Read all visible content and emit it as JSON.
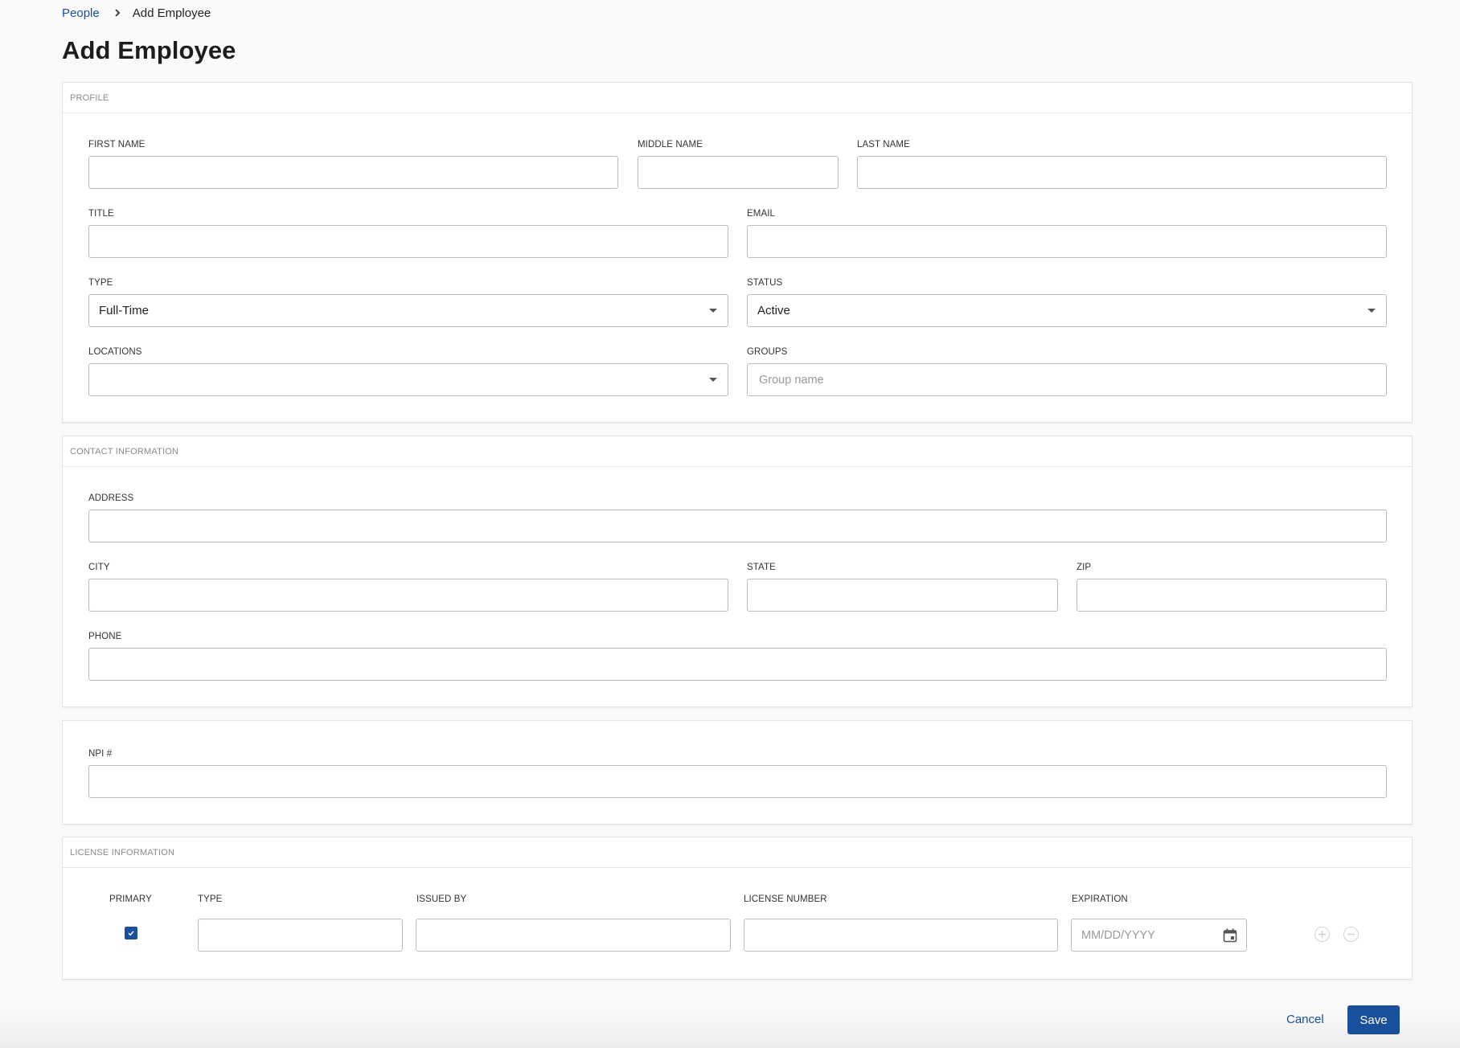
{
  "breadcrumb": {
    "parent": "People",
    "current": "Add Employee"
  },
  "page": {
    "title": "Add Employee"
  },
  "profile": {
    "header": "PROFILE",
    "first_name": {
      "label": "FIRST NAME",
      "value": ""
    },
    "middle_name": {
      "label": "MIDDLE NAME",
      "value": ""
    },
    "last_name": {
      "label": "LAST NAME",
      "value": ""
    },
    "title": {
      "label": "TITLE",
      "value": ""
    },
    "email": {
      "label": "EMAIL",
      "value": ""
    },
    "type": {
      "label": "TYPE",
      "value": "Full-Time"
    },
    "status": {
      "label": "STATUS",
      "value": "Active"
    },
    "locations": {
      "label": "LOCATIONS",
      "value": ""
    },
    "groups": {
      "label": "GROUPS",
      "placeholder": "Group name"
    }
  },
  "contact": {
    "header": "CONTACT INFORMATION",
    "address": {
      "label": "ADDRESS",
      "value": ""
    },
    "city": {
      "label": "CITY",
      "value": ""
    },
    "state": {
      "label": "STATE",
      "value": ""
    },
    "zip": {
      "label": "ZIP",
      "value": ""
    },
    "phone": {
      "label": "PHONE",
      "value": ""
    }
  },
  "npi": {
    "label": "NPI #",
    "value": ""
  },
  "license": {
    "header": "LICENSE INFORMATION",
    "columns": {
      "primary": "PRIMARY",
      "type": "TYPE",
      "issued_by": "ISSUED BY",
      "license_number": "LICENSE NUMBER",
      "expiration": "EXPIRATION"
    },
    "row": {
      "primary_checked": true,
      "expiration_placeholder": "MM/DD/YYYY"
    }
  },
  "actions": {
    "cancel": "Cancel",
    "save": "Save"
  },
  "colors": {
    "accent": "#1a4f9c",
    "border": "#bcbcbc",
    "background": "#fafafa"
  },
  "icons": {
    "breadcrumb_separator": "chevron-right-icon",
    "select_caret": "caret-down-icon",
    "date_picker": "calendar-icon",
    "add_row": "plus-circle-icon",
    "remove_row": "minus-circle-icon",
    "checkbox": "check-icon"
  }
}
